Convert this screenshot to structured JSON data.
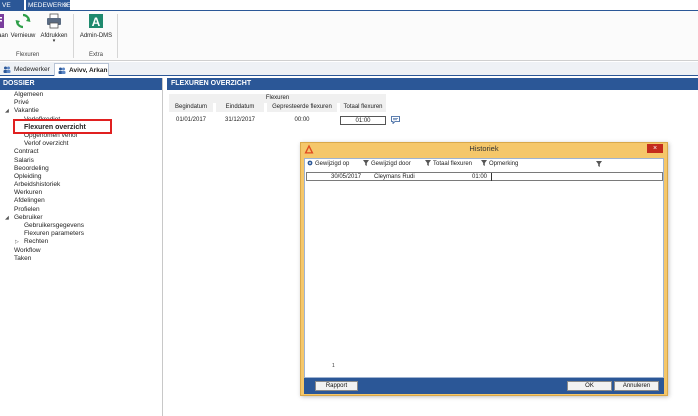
{
  "tabs": {
    "prev_label": "VE",
    "active_label": "MEDEWERKERS",
    "active_close": "X"
  },
  "ribbon": {
    "buttons": [
      {
        "label": "aan",
        "icon": "document-purple-icon"
      },
      {
        "label": "Vernieuw",
        "icon": "refresh-icon"
      },
      {
        "label": "Afdrukken",
        "icon": "printer-icon"
      },
      {
        "label": "Admin-DMS",
        "icon": "admin-dms-icon"
      }
    ],
    "group_flexuren": "Flexuren",
    "group_extra": "Extra"
  },
  "doctabs": [
    {
      "label": "Medewerker",
      "icon": "people-icon"
    },
    {
      "label": "Avivv, Arkan",
      "icon": "people-icon"
    }
  ],
  "left": {
    "title": "DOSSIER",
    "items": [
      {
        "label": "Algemeen",
        "indent": 0,
        "arrow": ""
      },
      {
        "label": "Privé",
        "indent": 0,
        "arrow": ""
      },
      {
        "label": "Vakantie",
        "indent": 0,
        "arrow": "◢"
      },
      {
        "label": "Verlofkrediet",
        "indent": 1,
        "arrow": ""
      },
      {
        "label": "Flexuren overzicht",
        "indent": 1,
        "arrow": "",
        "selected": true
      },
      {
        "label": "Opgenomen verlof",
        "indent": 1,
        "arrow": ""
      },
      {
        "label": "Verlof overzicht",
        "indent": 1,
        "arrow": ""
      },
      {
        "label": "Contract",
        "indent": 0,
        "arrow": ""
      },
      {
        "label": "Salaris",
        "indent": 0,
        "arrow": ""
      },
      {
        "label": "Beoordeling",
        "indent": 0,
        "arrow": ""
      },
      {
        "label": "Opleiding",
        "indent": 0,
        "arrow": ""
      },
      {
        "label": "Arbeidshistoriek",
        "indent": 0,
        "arrow": ""
      },
      {
        "label": "Werkuren",
        "indent": 0,
        "arrow": ""
      },
      {
        "label": "Afdelingen",
        "indent": 0,
        "arrow": ""
      },
      {
        "label": "Profielen",
        "indent": 0,
        "arrow": ""
      },
      {
        "label": "Gebruiker",
        "indent": 0,
        "arrow": "◢"
      },
      {
        "label": "Gebruikersgegevens",
        "indent": 1,
        "arrow": ""
      },
      {
        "label": "Flexuren parameters",
        "indent": 1,
        "arrow": ""
      },
      {
        "label": "Rechten",
        "indent": 1,
        "arrow": "▷"
      },
      {
        "label": "Workflow",
        "indent": 0,
        "arrow": ""
      },
      {
        "label": "Taken",
        "indent": 0,
        "arrow": ""
      }
    ]
  },
  "content": {
    "title": "FLEXUREN OVERZICHT",
    "group_header": "Flexuren",
    "columns": [
      "Begindatum",
      "Einddatum",
      "Gepresteerde flexuren",
      "Totaal flexuren"
    ],
    "row": [
      "01/01/2017",
      "31/12/2017",
      "00:00",
      "01:00"
    ]
  },
  "dialog": {
    "title": "Historiek",
    "close": "×",
    "columns": [
      "Gewijzigd op",
      "Gewijzigd door",
      "Totaal flexuren",
      "Opmerking"
    ],
    "row": [
      "30/05/2017",
      "Cleymans Rudi",
      "01:00",
      ""
    ],
    "pager": "1",
    "rapport": "Rapport",
    "ok": "OK",
    "annuleren": "Annuleren"
  },
  "colors": {
    "accent": "#2b5797",
    "dialog_frame": "#f5c76a",
    "highlight": "#e02020"
  }
}
